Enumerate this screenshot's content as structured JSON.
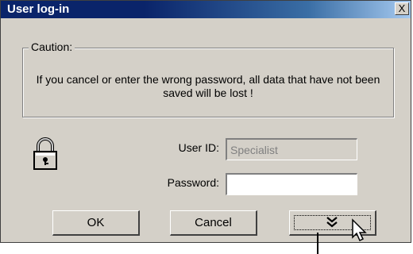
{
  "window": {
    "title": "User log-in",
    "close_label": "X"
  },
  "caution": {
    "legend": "Caution:",
    "message": "If you cancel or enter the wrong password, all data that have not been saved will be lost !"
  },
  "form": {
    "user_id_label": "User ID:",
    "user_id_value": "Specialist",
    "password_label": "Password:",
    "password_value": ""
  },
  "buttons": {
    "ok_label": "OK",
    "cancel_label": "Cancel"
  },
  "icons": {
    "lock": "lock-icon",
    "expand": "double-chevron-down-icon",
    "cursor": "mouse-pointer-icon"
  },
  "colors": {
    "titlebar_start": "#0a246a",
    "titlebar_end": "#a6caf0",
    "face": "#d4d0c8"
  }
}
